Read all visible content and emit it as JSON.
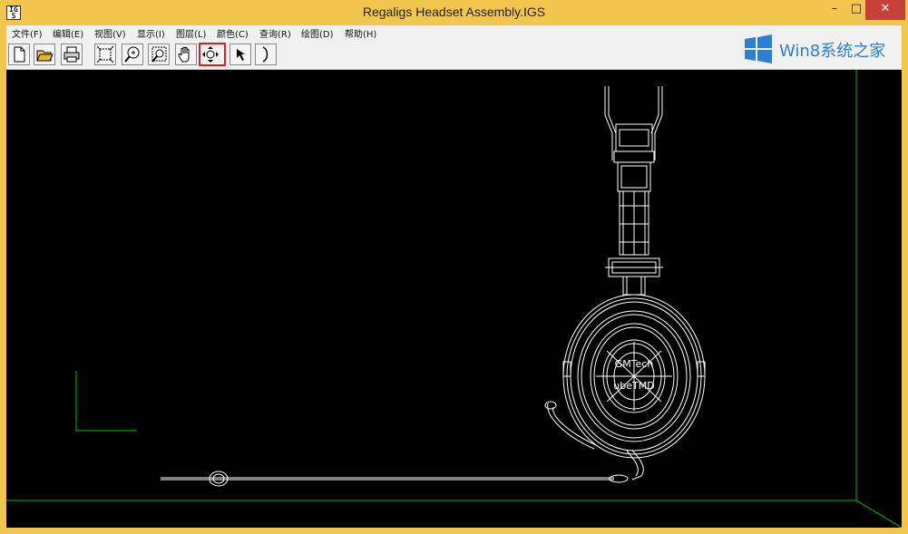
{
  "window": {
    "title": "Regaligs Headset Assembly.IGS",
    "app_icon_label": "IG\nS",
    "controls": {
      "minimize": "–",
      "maximize": "□",
      "close": "✕"
    }
  },
  "menu": {
    "items": [
      {
        "label": "文件(F)"
      },
      {
        "label": "编辑(E)"
      },
      {
        "label": "视图(V)"
      },
      {
        "label": "显示(I)"
      },
      {
        "label": "图层(L)"
      },
      {
        "label": "颜色(C)"
      },
      {
        "label": "查询(R)"
      },
      {
        "label": "绘图(D)"
      },
      {
        "label": "帮助(H)"
      }
    ]
  },
  "toolbar": {
    "buttons": [
      {
        "icon": "new-document-icon"
      },
      {
        "icon": "open-folder-icon"
      },
      {
        "icon": "print-icon"
      },
      {
        "icon": "zoom-extents-icon"
      },
      {
        "icon": "zoom-icon"
      },
      {
        "icon": "zoom-window-icon"
      },
      {
        "icon": "pan-hand-icon"
      },
      {
        "icon": "rotate-icon",
        "selected": true
      },
      {
        "icon": "select-arrow-icon"
      },
      {
        "icon": "arc-icon"
      }
    ],
    "selected_color": "#e02020"
  },
  "watermark": {
    "text": "Win8系统之家",
    "color": "#2b7fd4"
  },
  "viewport": {
    "background": "#000000",
    "axis_color": "#00c000",
    "model_color": "#ffffff",
    "model_labels": [
      "GMTech",
      "ubeTMD"
    ]
  }
}
